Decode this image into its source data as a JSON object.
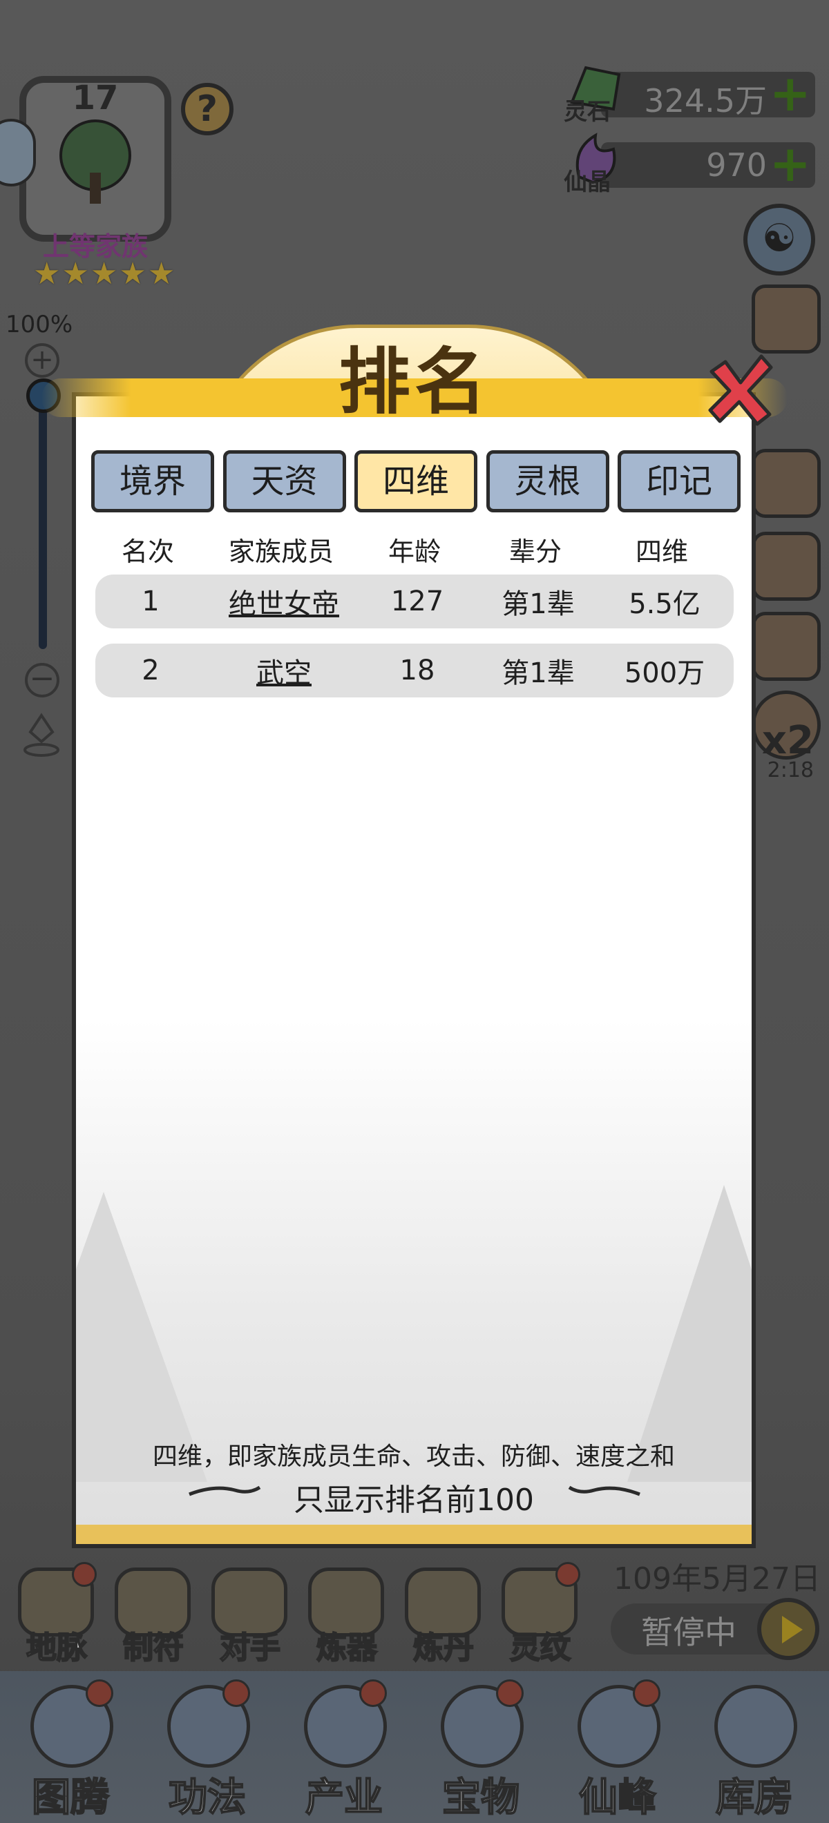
{
  "top_left": {
    "level": "17",
    "family_rank": "上等家族",
    "stars": 5,
    "help": "?",
    "zoom_percent": "100%",
    "zoom_plus": "+",
    "zoom_minus": "−"
  },
  "currencies": {
    "spirit_stone": {
      "label": "灵石",
      "amount": "324.5万"
    },
    "fairy_crystal": {
      "label": "仙晶",
      "amount": "970"
    },
    "plus": "+"
  },
  "speed": {
    "multiplier": "x2",
    "timer": "2:18"
  },
  "dialog": {
    "title": "排名",
    "tabs": [
      "境界",
      "天资",
      "四维",
      "灵根",
      "印记"
    ],
    "active_tab_index": 2,
    "columns": [
      "名次",
      "家族成员",
      "年龄",
      "辈分",
      "四维"
    ],
    "rows": [
      {
        "rank": "1",
        "name": "绝世女帝",
        "age": "127",
        "generation": "第1辈",
        "stat": "5.5亿"
      },
      {
        "rank": "2",
        "name": "武空",
        "age": "18",
        "generation": "第1辈",
        "stat": "500万"
      }
    ],
    "note": "四维，即家族成员生命、攻击、防御、速度之和",
    "limit_note": "只显示排名前100"
  },
  "game_date": "109年5月27日",
  "pause_label": "暂停中",
  "function_row": [
    "地脉",
    "制符",
    "对手",
    "炼器",
    "炼丹",
    "灵纹"
  ],
  "bottom_nav": [
    "图腾",
    "功法",
    "产业",
    "宝物",
    "仙峰",
    "库房"
  ],
  "colors": {
    "tab_active": "#ffe6a6",
    "tab_inactive": "#a5b7cf",
    "title_gold": "#f4c430",
    "close_red": "#e0404a",
    "plus_green": "#3a6b1a"
  }
}
